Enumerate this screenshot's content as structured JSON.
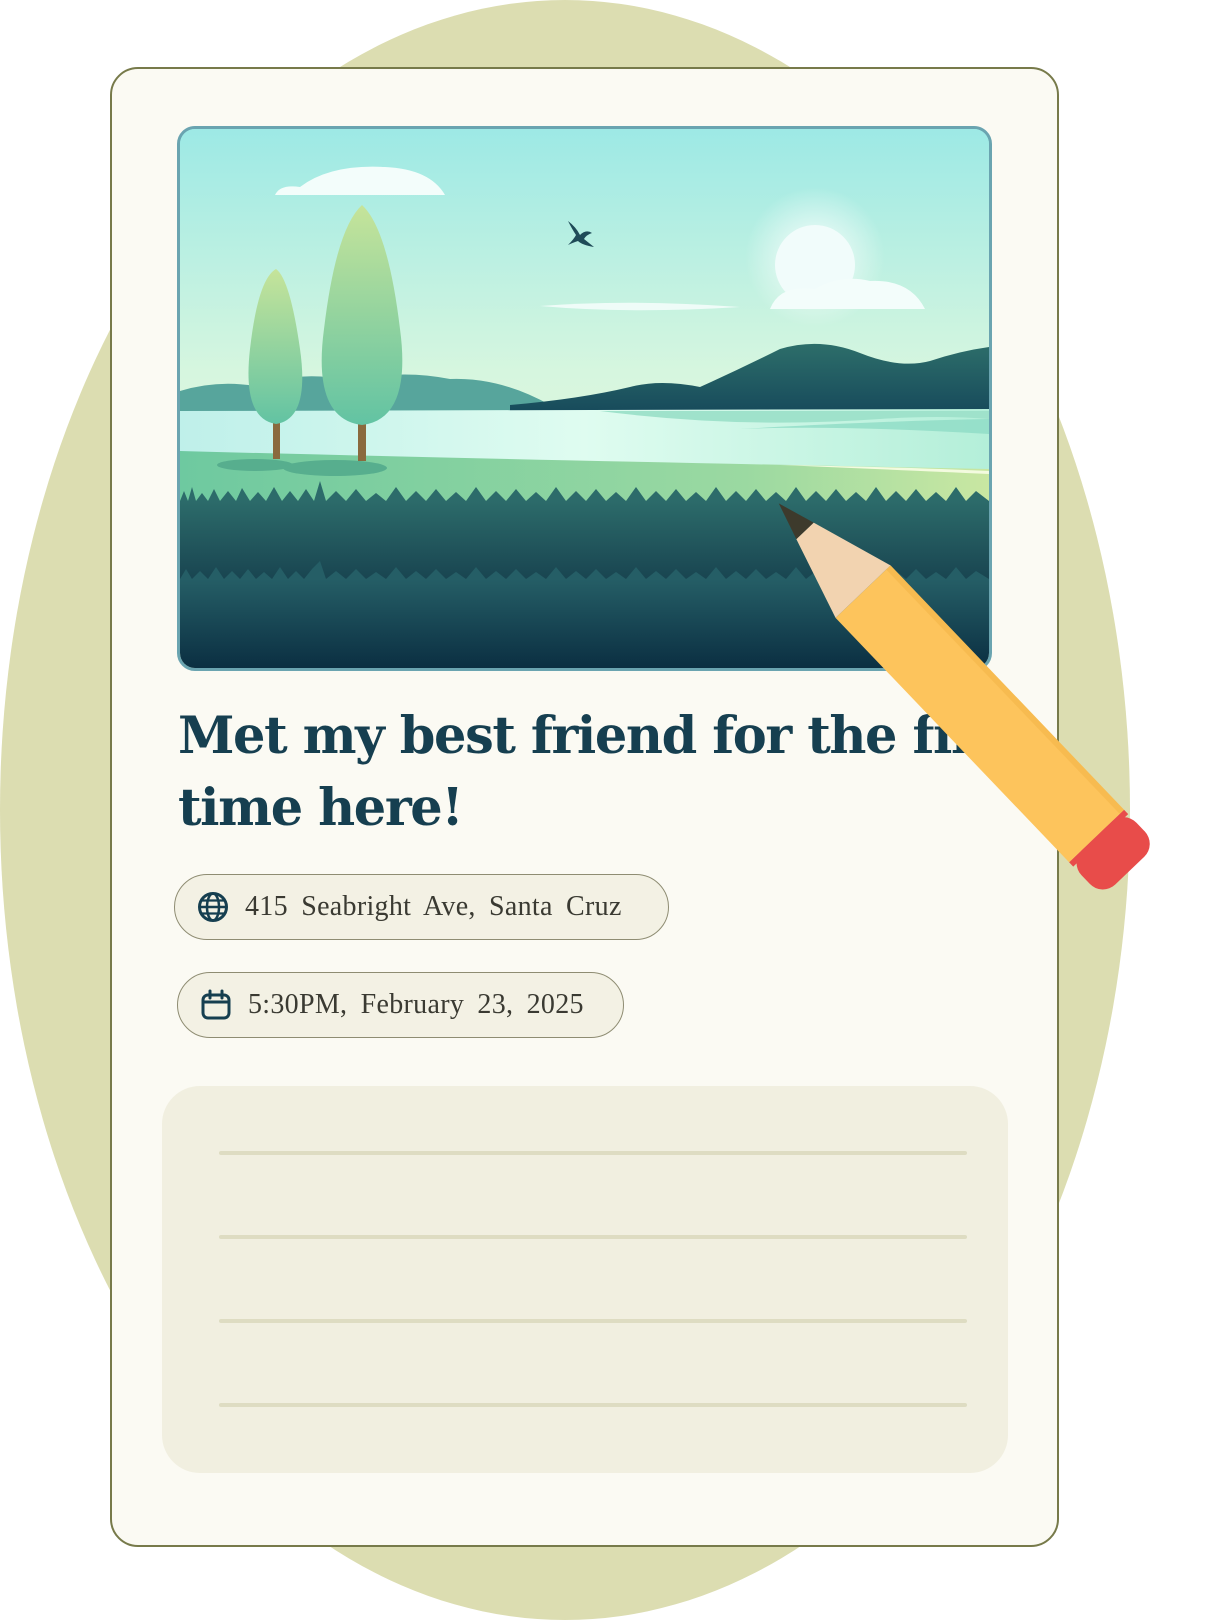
{
  "post": {
    "title": "Met my best friend for the first time here!",
    "location": {
      "icon": "globe-icon",
      "text": "415 Seabright Ave, Santa Cruz"
    },
    "datetime": {
      "icon": "calendar-icon",
      "text": "5:30PM, February 23, 2025"
    },
    "notes": {
      "line_count": 4,
      "text": ""
    }
  },
  "photo": {
    "subject": "landscape-illustration",
    "elements": [
      "sun",
      "clouds",
      "bird",
      "trees",
      "mountains",
      "lake",
      "grass"
    ]
  },
  "decoration": {
    "pencil_icon": "pencil-icon"
  },
  "colors": {
    "background_blob": "#dcddb1",
    "card": "#fbfaf3",
    "card_border": "#777a4a",
    "title": "#163f50",
    "chip_bg": "#f3f1e4",
    "notes_bg": "#f1efe0",
    "pencil_body": "#fdc45c",
    "pencil_eraser": "#e84c4a"
  }
}
